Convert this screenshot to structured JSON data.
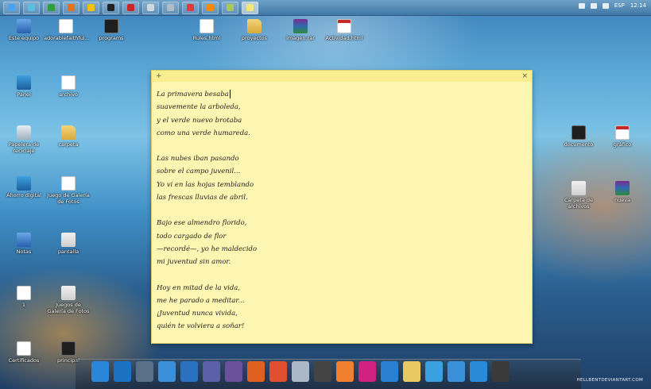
{
  "taskbar": {
    "buttons": [
      {
        "icon": "windows-icon",
        "color": "#4aa3f0"
      },
      {
        "icon": "explorer-icon",
        "color": "#5bc0de"
      },
      {
        "icon": "app-green-icon",
        "color": "#2e9e40"
      },
      {
        "icon": "firefox-icon",
        "color": "#e8701a"
      },
      {
        "icon": "chrome-icon",
        "color": "#f2c200"
      },
      {
        "icon": "terminal-icon",
        "color": "#222222"
      },
      {
        "icon": "pdf-icon",
        "color": "#c62828"
      },
      {
        "icon": "window-icon",
        "color": "#d0d8e0"
      },
      {
        "icon": "window-icon",
        "color": "#b0bcc8"
      },
      {
        "icon": "chrome-icon",
        "color": "#e53935"
      },
      {
        "icon": "media-icon",
        "color": "#ff8c00"
      },
      {
        "icon": "folder-icon",
        "color": "#a8c858"
      },
      {
        "icon": "sticky-notes-icon",
        "color": "#f3e77a"
      }
    ],
    "tray": {
      "lang": "ESP",
      "time": "12:14"
    }
  },
  "desktop_icons": [
    {
      "label": "Este equipo",
      "type": "pc"
    },
    {
      "label": "adorablefaithful...",
      "type": "doc"
    },
    {
      "label": "programs",
      "type": "dark"
    },
    {
      "label": "Rules.html",
      "type": "doc"
    },
    {
      "label": "proyectos",
      "type": "folder"
    },
    {
      "label": "imagen.rar",
      "type": "rar"
    },
    {
      "label": "Actividad.html",
      "type": "pdf"
    },
    {
      "label": "Panel",
      "type": "app"
    },
    {
      "label": "archivo",
      "type": "doc"
    },
    {
      "label": "Papelera de reciclaje",
      "type": "bin"
    },
    {
      "label": "carpeta",
      "type": "folder"
    },
    {
      "label": "Ahorro digital",
      "type": "app"
    },
    {
      "label": "Juego de Galería de Fotos",
      "type": "doc"
    },
    {
      "label": "Notas",
      "type": "pc"
    },
    {
      "label": "pantalla",
      "type": "win"
    },
    {
      "label": "1",
      "type": "doc"
    },
    {
      "label": "Juegos de Galería de Fotos",
      "type": "win"
    },
    {
      "label": "Certificados",
      "type": "doc"
    },
    {
      "label": "principal",
      "type": "dark"
    },
    {
      "label": "documento",
      "type": "dark"
    },
    {
      "label": "gráfico",
      "type": "pdf"
    },
    {
      "label": "Carpeta de archivos",
      "type": "win"
    },
    {
      "label": "nueva",
      "type": "rar"
    }
  ],
  "note": {
    "stanzas": [
      [
        "La primavera besaba",
        "suavemente la arboleda,",
        "y el verde nuevo brotaba",
        "como una verde humareda."
      ],
      [
        "Las nubes iban pasando",
        "sobre el campo juvenil...",
        "Yo vi en las hojas temblando",
        "las frescas lluvias de abril."
      ],
      [
        "Bajo ese almendro florido,",
        "todo cargado de flor",
        "—recordé—, yo he maldecido",
        "mi juventud sin amor."
      ],
      [
        "Hoy en mitad de la vida,",
        "me he parado a meditar...",
        "¡Juventud nunca vivida,",
        "quién te volviera a soñar!"
      ]
    ]
  },
  "dock": {
    "items": [
      {
        "icon": "folder-blue-icon",
        "color": "#2a86d9"
      },
      {
        "icon": "windows-tile-icon",
        "color": "#1e70c0"
      },
      {
        "icon": "cube-icon",
        "color": "#5a6f88"
      },
      {
        "icon": "dash-icon",
        "color": "#3b8fd8"
      },
      {
        "icon": "screenshot-icon",
        "color": "#2a72c0"
      },
      {
        "icon": "circle-icon",
        "color": "#5a5fa8"
      },
      {
        "icon": "circle-icon",
        "color": "#6a4f9a"
      },
      {
        "icon": "download-icon",
        "color": "#e06020"
      },
      {
        "icon": "git-icon",
        "color": "#e05030"
      },
      {
        "icon": "browser-icon",
        "color": "#aab8c8"
      },
      {
        "icon": "video-icon",
        "color": "#444444"
      },
      {
        "icon": "home-icon",
        "color": "#f08030"
      },
      {
        "icon": "app-pink-icon",
        "color": "#d02080"
      },
      {
        "icon": "edge-icon",
        "color": "#2a7fd0"
      },
      {
        "icon": "folder-icon",
        "color": "#e8c860"
      },
      {
        "icon": "window-icon",
        "color": "#3aa0e0"
      },
      {
        "icon": "chat-icon",
        "color": "#3a90d8"
      },
      {
        "icon": "gear-icon",
        "color": "#2a8ad8"
      },
      {
        "icon": "screen-icon",
        "color": "#3a3a3a"
      }
    ]
  },
  "watermark": "HELLBENTDEVIANTART.COM"
}
